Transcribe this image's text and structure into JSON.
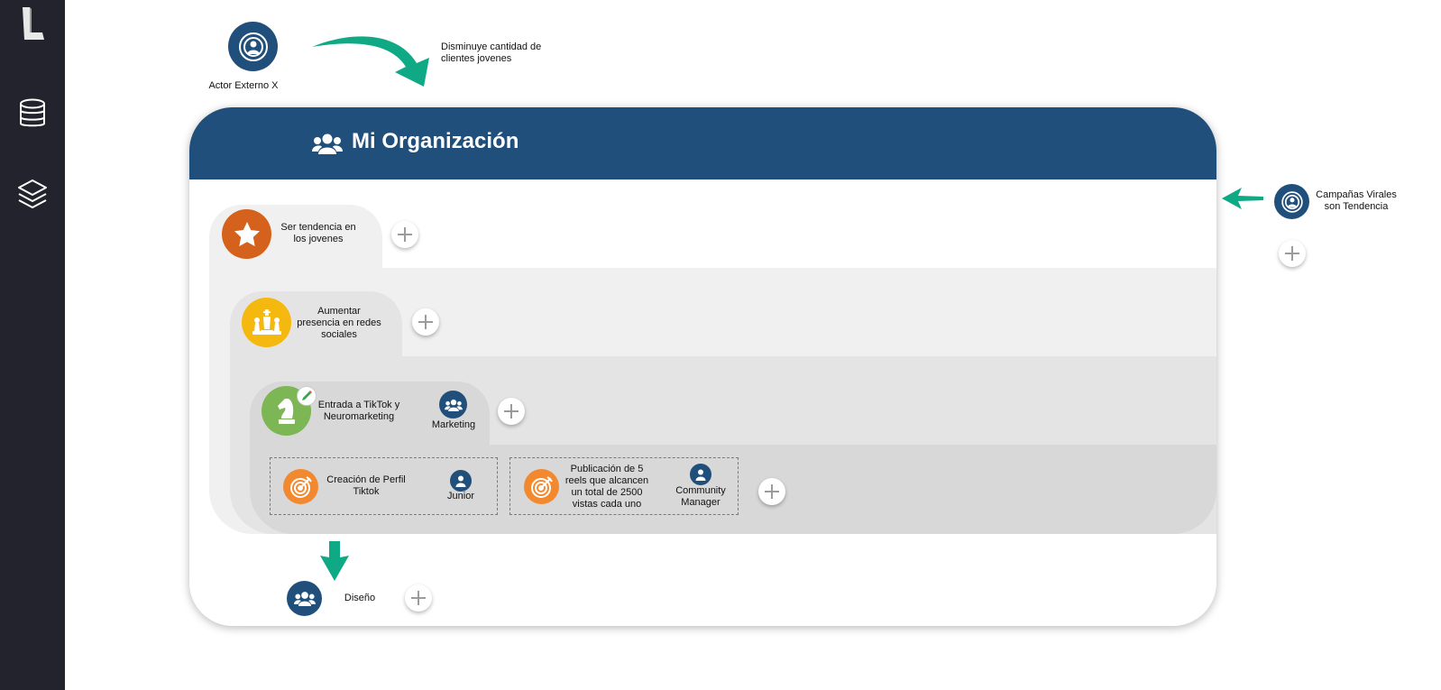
{
  "sidebar": {
    "items": [
      {
        "name": "logo",
        "icon": "logo-icon"
      },
      {
        "name": "database",
        "icon": "database-icon"
      },
      {
        "name": "layers",
        "icon": "layers-icon"
      }
    ]
  },
  "external_actor_top": {
    "label": "Actor Externo X",
    "effect_label": "Disminuye cantidad de clientes jovenes",
    "icon": "broadcast-person-icon"
  },
  "external_actor_right": {
    "label": "Campañas Virales son Tendencia",
    "icon": "broadcast-person-icon"
  },
  "organization": {
    "title": "Mi Organización",
    "icon": "users-icon",
    "levels": {
      "purpose": {
        "label": "Ser tendencia en los jovenes",
        "icon": "star-icon",
        "color": "#d4621c"
      },
      "objective": {
        "label": "Aumentar presencia en redes sociales",
        "icon": "chess-pieces-icon",
        "color": "#f5b80f"
      },
      "strategy": {
        "label": "Entrada a TikTok y Neuromarketing",
        "icon": "chess-knight-icon",
        "color": "#7cb655",
        "owner": "Marketing",
        "owner_icon": "users-icon"
      },
      "tactics": [
        {
          "label": "Creación de Perfil Tiktok",
          "icon": "target-icon",
          "color": "#f3892f",
          "owner": "Junior",
          "owner_icon": "person-icon"
        },
        {
          "label": "Publicación de 5 reels que alcancen un total de 2500 vistas cada uno",
          "icon": "target-icon",
          "color": "#f3892f",
          "owner": "Community Manager",
          "owner_icon": "person-icon"
        }
      ]
    },
    "sub_area": {
      "label": "Diseño",
      "icon": "users-icon"
    }
  },
  "colors": {
    "navy": "#214f7b",
    "green_arrow": "#0fa986",
    "sidebar": "#23232d"
  }
}
